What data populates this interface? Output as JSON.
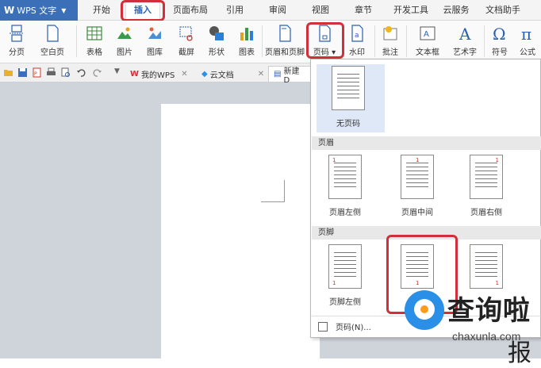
{
  "app": {
    "name": "WPS 文字"
  },
  "menu_tabs": [
    "开始",
    "插入",
    "页面布局",
    "引用",
    "审阅",
    "视图",
    "章节",
    "开发工具",
    "云服务",
    "文档助手"
  ],
  "ribbon": {
    "break": "分页",
    "blank_page": "空白页",
    "table": "表格",
    "picture": "图片",
    "gallery": "图库",
    "screenshot": "截屏",
    "shapes": "形状",
    "chart": "图表",
    "header_footer": "页眉和页脚",
    "page_number": "页码",
    "watermark": "水印",
    "comment": "批注",
    "textbox": "文本框",
    "wordart": "艺术字",
    "symbol": "符号",
    "formula": "公式"
  },
  "doc_tabs": {
    "my_wps": "我的WPS",
    "cloud_docs": "云文档",
    "new_doc": "新建 D"
  },
  "dropdown": {
    "none": "无页码",
    "header_section": "页眉",
    "header_left": "页眉左侧",
    "header_center": "页眉中间",
    "header_right": "页眉右侧",
    "footer_section": "页脚",
    "footer_left": "页脚左侧",
    "page_number_menu": "页码(N)...",
    "page_no": "1"
  },
  "watermark": {
    "title": "查询啦",
    "sub": "chaxunla.com",
    "partial": "报"
  },
  "colors": {
    "accent": "#3b6fb8",
    "highlight": "#d32f3a",
    "icon_blue": "#2a8fe6",
    "icon_orange": "#ff9b1a"
  }
}
